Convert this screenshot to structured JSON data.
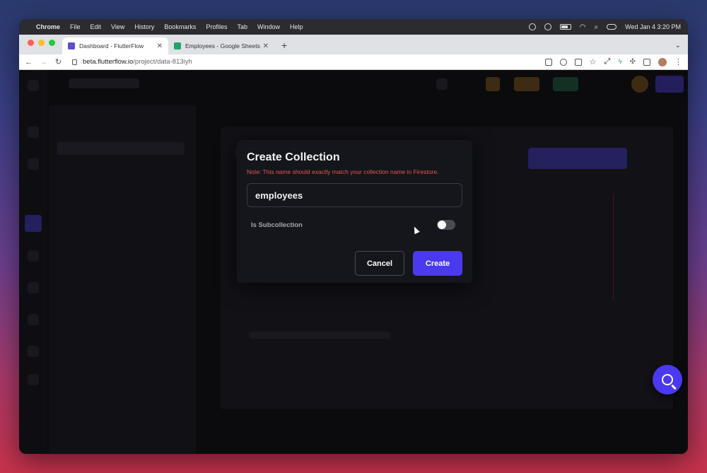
{
  "menubar": {
    "app_name": "Chrome",
    "items": [
      "File",
      "Edit",
      "View",
      "History",
      "Bookmarks",
      "Profiles",
      "Tab",
      "Window",
      "Help"
    ],
    "datetime": "Wed Jan 4  3:20 PM"
  },
  "tabs": [
    {
      "title": "Dashboard - FlutterFlow",
      "favicon": "flutterflow-icon",
      "active": true
    },
    {
      "title": "Employees - Google Sheets",
      "favicon": "google-sheets-icon",
      "active": false
    }
  ],
  "address_bar": {
    "domain": "beta.flutterflow.io",
    "path": "/project/data-813iyh"
  },
  "modal": {
    "title": "Create Collection",
    "note": "Note: This name should exactly match your collection name in Firestore.",
    "name_value": "employees",
    "subcollection_label": "Is Subcollection",
    "subcollection_on": false,
    "cancel_label": "Cancel",
    "create_label": "Create"
  },
  "colors": {
    "accent": "#4b39ef",
    "note": "#e05a4e",
    "modal_bg": "#15161b"
  }
}
